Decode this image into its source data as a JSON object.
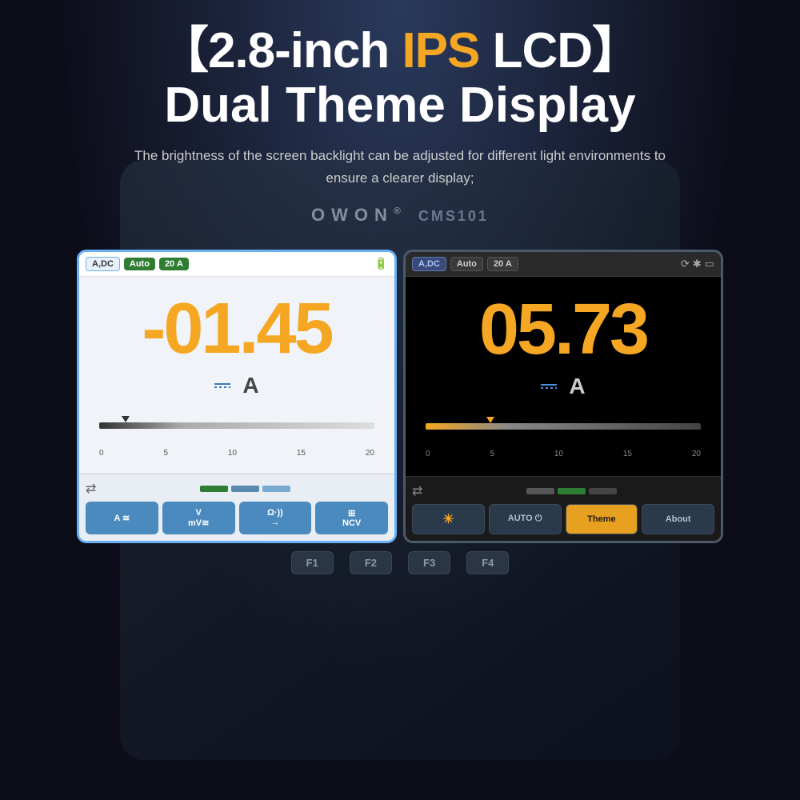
{
  "page": {
    "title_line1": "【2.8-inch IPS LCD】",
    "title_line1_bracket_open": "【2.8-inch ",
    "title_line1_ips": "IPS",
    "title_line1_rest": " LCD】",
    "title_line2": "Dual Theme Display",
    "subtitle": "The brightness of the screen backlight can be adjusted for different light environments to ensure a clearer display;",
    "brand": "OWON",
    "brand_model": "CMS101"
  },
  "screen_light": {
    "tag_adc": "A,DC",
    "tag_auto": "Auto",
    "tag_20a": "20 A",
    "main_value": "-01.45",
    "unit": "A",
    "scale_labels": [
      "0",
      "5",
      "10",
      "15",
      "20"
    ],
    "fn_buttons": [
      "A ≅",
      "V\nmV≅",
      "Ω·))\n→",
      "⊞\nNCV"
    ]
  },
  "screen_dark": {
    "tag_adc": "A,DC",
    "tag_auto": "Auto",
    "tag_20a": "20 A",
    "main_value": "05.73",
    "unit": "A",
    "scale_labels": [
      "0",
      "5",
      "10",
      "15",
      "20"
    ],
    "fn_buttons": [
      "☀",
      "AUTO ⏻",
      "Theme",
      "About"
    ]
  },
  "fkeys": [
    "F1",
    "F2",
    "F3",
    "F4"
  ],
  "colors": {
    "orange": "#f5a623",
    "green": "#2e7d32",
    "blue": "#4a8abf",
    "dark_bg": "#000000",
    "light_bg": "#f0f4f8"
  }
}
